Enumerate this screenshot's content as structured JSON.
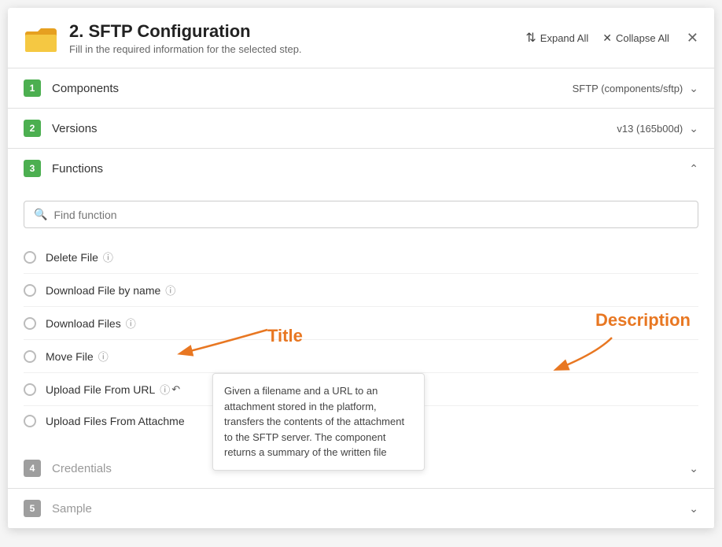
{
  "modal": {
    "title": "2. SFTP Configuration",
    "subtitle": "Fill in the required information for the selected step.",
    "expand_all": "Expand All",
    "collapse_all": "Collapse All"
  },
  "sections": [
    {
      "id": 1,
      "label": "Components",
      "value": "SFTP (components/sftp)",
      "expanded": false,
      "active": true
    },
    {
      "id": 2,
      "label": "Versions",
      "value": "v13 (165b00d)",
      "expanded": false,
      "active": true
    },
    {
      "id": 3,
      "label": "Functions",
      "expanded": true,
      "active": true
    },
    {
      "id": 4,
      "label": "Credentials",
      "expanded": false,
      "active": false
    },
    {
      "id": 5,
      "label": "Sample",
      "expanded": false,
      "active": false
    }
  ],
  "search": {
    "placeholder": "Find function"
  },
  "functions": [
    {
      "name": "Delete File",
      "has_info": true,
      "selected": false
    },
    {
      "name": "Download File by name",
      "has_info": true,
      "selected": false
    },
    {
      "name": "Download Files",
      "has_info": true,
      "selected": false
    },
    {
      "name": "Move File",
      "has_info": true,
      "selected": false
    },
    {
      "name": "Upload File From URL",
      "has_info": true,
      "selected": false,
      "show_tooltip": true
    },
    {
      "name": "Upload Files From Attachme",
      "has_info": false,
      "selected": false
    }
  ],
  "tooltip": {
    "text": "Given a filename and a URL to an attachment stored in the platform, transfers the contents of the attachment to the SFTP server. The component returns a summary of the written file"
  },
  "annotations": {
    "title_label": "Title",
    "description_label": "Description"
  }
}
